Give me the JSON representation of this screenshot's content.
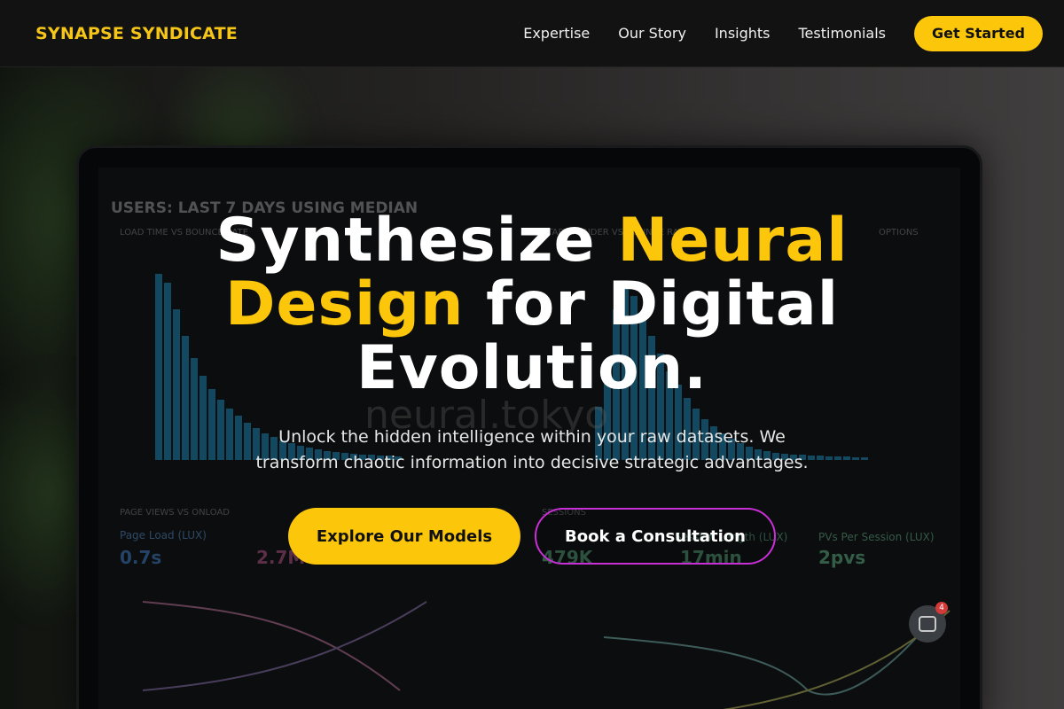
{
  "nav": {
    "brand": "SYNAPSE SYNDICATE",
    "links": [
      "Expertise",
      "Our Story",
      "Insights",
      "Testimonials"
    ],
    "cta_label": "Get Started"
  },
  "hero": {
    "headline_part1": "Synthesize ",
    "headline_accent1": "Neural",
    "headline_accent2": "Design",
    "headline_part2": " for Digital",
    "headline_part3": "Evolution.",
    "subline_line1": "Unlock the hidden intelligence within your raw datasets. We",
    "subline_line2": "transform chaotic information into decisive strategic advantages.",
    "primary_cta": "Explore Our Models",
    "secondary_cta": "Book a Consultation"
  },
  "background_dashboard": {
    "title": "USERS: LAST 7 DAYS USING MEDIAN",
    "panel1_label": "LOAD TIME VS BOUNCE RATE",
    "panel2_label": "START RENDER VS BOUNCE RATE",
    "panel3_label": "PAGE VIEWS VS ONLOAD",
    "panel4_label": "SESSIONS",
    "options_label": "OPTIONS",
    "metric1_label": "Page Load (LUX)",
    "metric1_value": "0.7s",
    "metric2_value": "2.7M",
    "metric3_label": "Session Length (LUX)",
    "metric3_value": "479K",
    "metric4_value": "17min",
    "metric5_label": "PVs Per Session (LUX)",
    "metric5_value": "2pvs",
    "watermark": "neural.tokyo"
  },
  "chat": {
    "badge_count": "4"
  },
  "colors": {
    "accent": "#fcc60a",
    "secondary_border": "#c92fd6",
    "nav_bg": "#121212"
  }
}
